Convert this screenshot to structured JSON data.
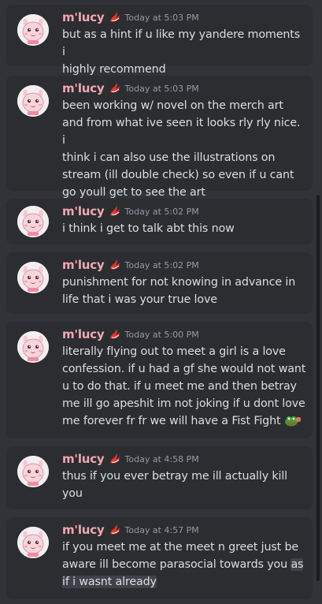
{
  "messages": [
    {
      "author": "m'lucy",
      "time": "Today at 5:03 PM",
      "lines": [
        "but as a hint if u like my yandere moments i",
        "highly recommend"
      ]
    },
    {
      "author": "m'lucy",
      "time": "Today at 5:03 PM",
      "lines": [
        "been working w/ novel on the merch art",
        "and from what ive seen it looks rly rly nice. i",
        "think i can also use the illustrations on",
        "stream (ill double check) so even if u cant",
        "go youll get to see the art"
      ]
    },
    {
      "author": "m'lucy",
      "time": "Today at 5:02 PM",
      "lines": [
        "i think i get to talk abt this now"
      ]
    },
    {
      "author": "m'lucy",
      "time": "Today at 5:02 PM",
      "lines": [
        "punishment for not knowing in advance in",
        "life that i was your true love"
      ]
    },
    {
      "author": "m'lucy",
      "time": "Today at 5:00 PM",
      "lines": [
        "literally flying out to meet a girl is a love",
        "confession. if u had a gf she would not want",
        "u to do that. if u meet me and then betray",
        "me ill go apeshit im not joking if u dont love",
        "me forever fr fr we will have a Fist Fight"
      ],
      "emoji": "pepe-fist-fight-emoji"
    },
    {
      "author": "m'lucy",
      "time": "Today at 4:58 PM",
      "lines": [
        "thus if you ever betray me ill actually kill",
        "you"
      ]
    },
    {
      "author": "m'lucy",
      "time": "Today at 4:57 PM",
      "lines": [
        "if you meet me at the meet n greet just be",
        "aware ill become parasocial towards you "
      ],
      "highlight_a": "as",
      "highlight_b": "if i wasnt already"
    }
  ],
  "colors": {
    "background": "#313338",
    "message_bg": "#2b2d31",
    "author": "#f4a7b3",
    "timestamp": "#949ba4",
    "text": "#dbdee1"
  },
  "icons": {
    "avatar": "pink-creature-avatar",
    "role": "red-swirl-role-icon"
  }
}
